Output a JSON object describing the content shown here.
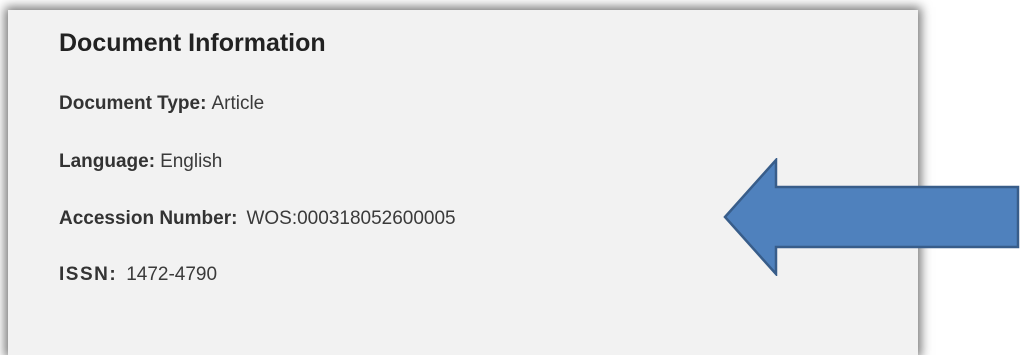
{
  "panel": {
    "title": "Document Information",
    "fields": [
      {
        "label": "Document Type:",
        "value": "Article"
      },
      {
        "label": "Language:",
        "value": "English"
      },
      {
        "label": "Accession Number:",
        "value": "WOS:000318052600005"
      },
      {
        "label": "ISSN:",
        "value": "1472-4790"
      }
    ]
  },
  "arrow": {
    "fill_color": "#4f81bd",
    "stroke_color": "#385d8a",
    "icon": "left-arrow-icon"
  }
}
